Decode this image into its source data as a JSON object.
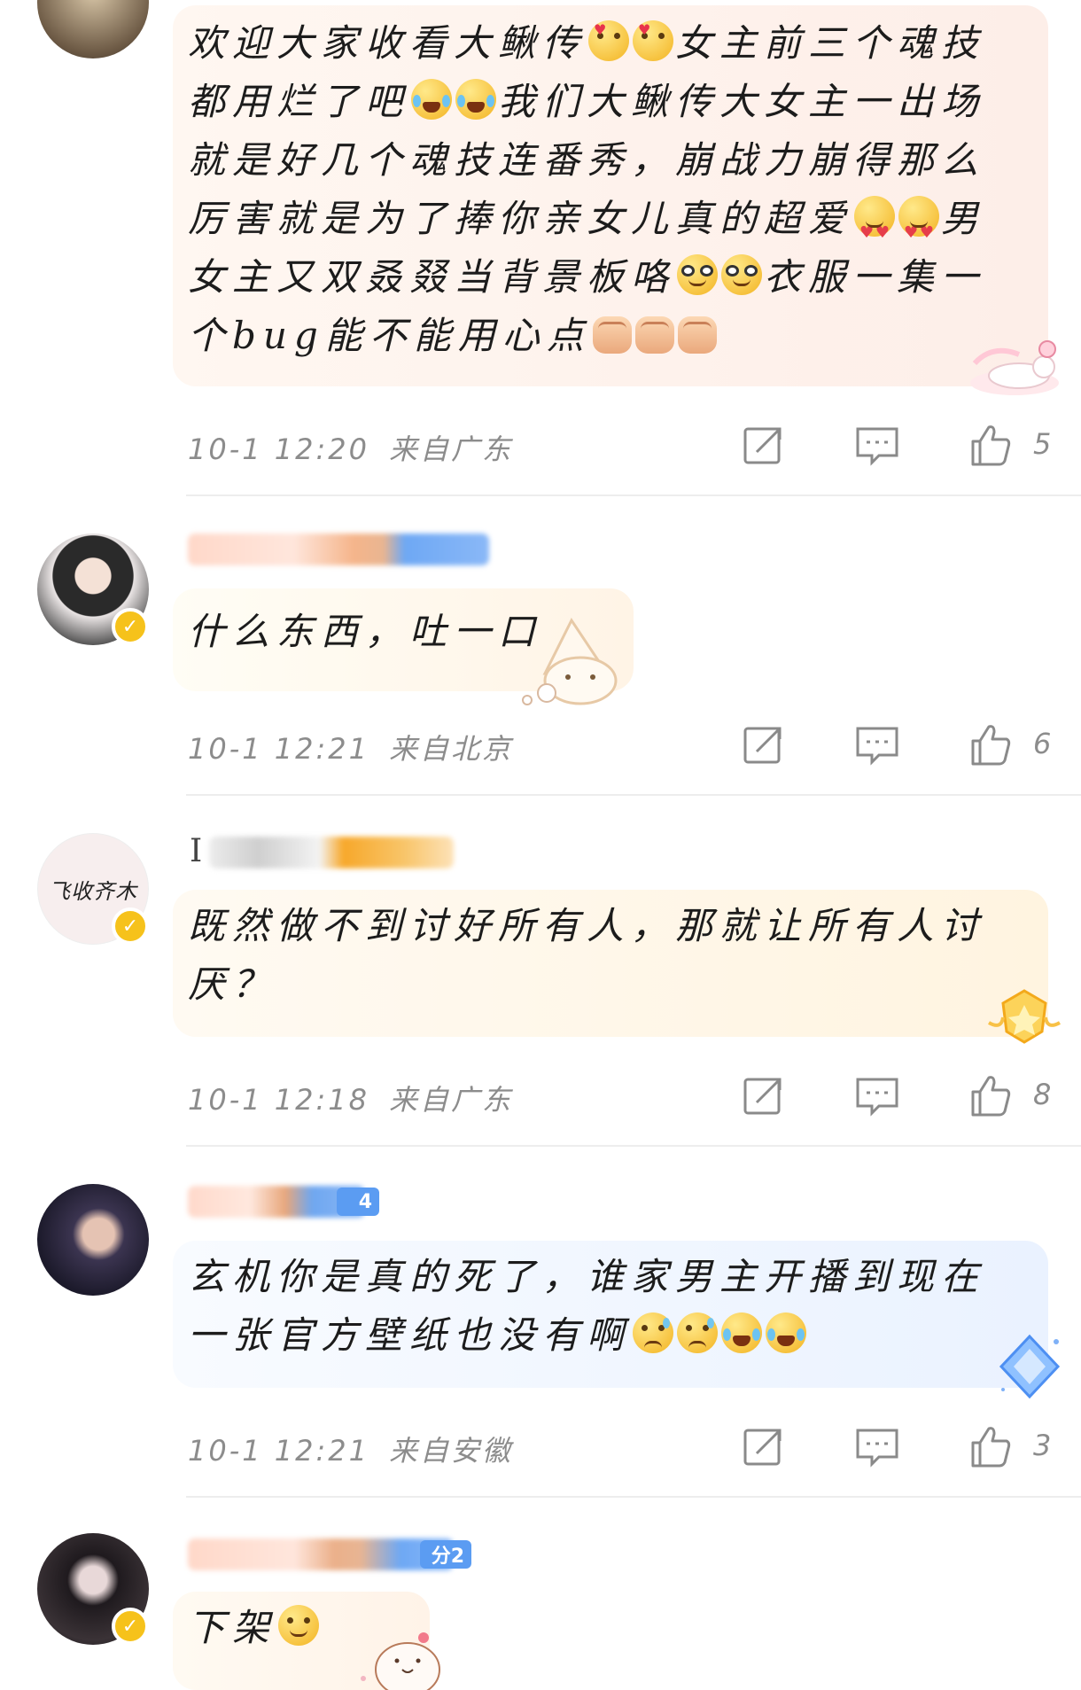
{
  "comments": [
    {
      "lines": [
        "欢迎大家收看大鳅传",
        "女主前三个魂技",
        "都用烂了吧",
        "我们大鳅传大女主一出场",
        "就是好几个魂技连番秀，崩战力崩得那么",
        "厉害就是为了捧你亲女儿真的超爱",
        "男",
        "女主又双叒叕当背景板咯",
        "衣服一集一",
        "个bug能不能用心点"
      ],
      "date": "10-1 12:20",
      "location": "来自广东",
      "likes": "5"
    },
    {
      "text": "什么东西，吐一口",
      "date": "10-1 12:21",
      "location": "来自北京",
      "likes": "6"
    },
    {
      "name_initial": "I",
      "lines": [
        "既然做不到讨好所有人，那就让所有人讨",
        "厌？"
      ],
      "date": "10-1 12:18",
      "location": "来自广东",
      "likes": "8"
    },
    {
      "badge_level": "4",
      "lines": [
        "玄机你是真的死了，谁家男主开播到现在",
        "一张官方壁纸也没有啊"
      ],
      "date": "10-1 12:21",
      "location": "来自安徽",
      "likes": "3"
    },
    {
      "badge_level": "分2",
      "text": "下架"
    }
  ],
  "avatar3_calligraphy": "飞收齐木",
  "colors": {
    "vip_badge": "#f6c21b",
    "fan_badge_blue": "#5b9cf2",
    "fan_badge_orange": "#f5a623",
    "meta_gray": "#8c8c8c"
  },
  "icons": [
    "share-icon",
    "comment-icon",
    "like-icon"
  ]
}
